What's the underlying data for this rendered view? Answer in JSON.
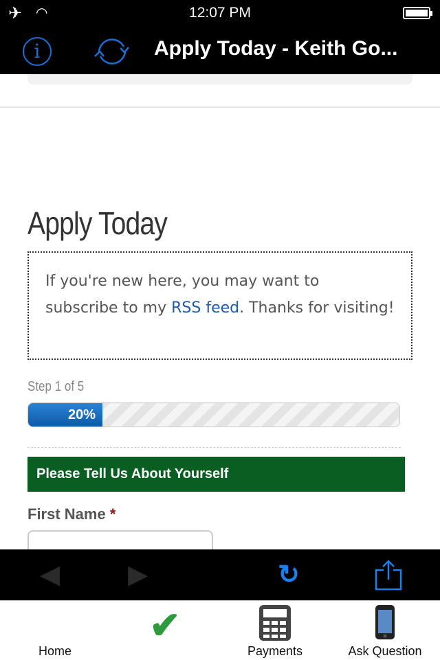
{
  "status": {
    "time": "12:07 PM"
  },
  "nav": {
    "title": "Apply Today - Keith Go..."
  },
  "page": {
    "heading": "Apply Today",
    "notice_pre": "If you're new here, you may want to subscribe to my ",
    "notice_link": "RSS feed",
    "notice_post": ". Thanks for visiting!",
    "step": "Step 1 of 5",
    "progress_percent": 20,
    "progress_label": "20%",
    "section_title": "Please Tell Us About Yourself",
    "first_name_label": "First Name",
    "required_mark": "*",
    "first_name_value": ""
  },
  "tabs": [
    {
      "label": "Home",
      "icon": ""
    },
    {
      "label": "",
      "icon": "checkmark-icon"
    },
    {
      "label": "Payments",
      "icon": "calculator-icon"
    },
    {
      "label": "Ask Question",
      "icon": "phone-icon"
    }
  ],
  "colors": {
    "accent": "#1a6fd6",
    "section": "#0a5e22",
    "progress": "#1a6fc0"
  }
}
